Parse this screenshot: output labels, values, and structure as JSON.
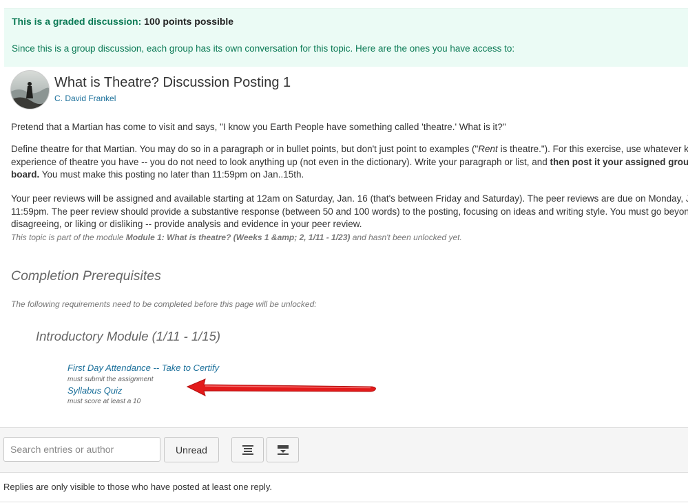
{
  "graded": {
    "label": "This is a graded discussion:",
    "points": "100 points possible",
    "group_note": "Since this is a group discussion, each group has its own conversation for this topic. Here are the ones you have access to:"
  },
  "topic": {
    "title": "What is Theatre? Discussion Posting 1",
    "author": "C. David Frankel"
  },
  "body": {
    "p1": "Pretend that a Martian has come to visit and says, \"I know you Earth People have something called 'theatre.'  What is it?\"",
    "p2_line1_a": "Define theatre for that Martian.  You may do so in a paragraph or in bullet points, but don't just point to examples (\"",
    "p2_line1_em": "Rent",
    "p2_line1_b": " is theatre.\").  For this exercise, use whatever k",
    "p2_line2_a": "experience of theatre you have -- you do not need to look anything up (not even in the dictionary).  Write your paragraph or list, and ",
    "p2_line2_bold": "then post it your assigned grou",
    "p2_line3_bold": "board.",
    "p2_line3_b": "  You must make this posting no later than 11:59pm on Jan..15th.",
    "p3_line1": "Your peer reviews will be assigned and available starting at 12am on Saturday, Jan. 16 (that's between Friday and Saturday).  The peer reviews are due on Monday, J",
    "p3_line2": "11:59pm. The peer review should provide a substantive response (between 50 and 100 words) to the posting, focusing on ideas and writing style.  You must go beyond",
    "p3_line3": "disagreeing, or liking or disliking -- provide analysis and evidence in your peer review."
  },
  "lock_note": {
    "before": "This topic is part of the module ",
    "module": "Module 1: What is theatre? (Weeks 1 &amp; 2, 1/11 - 1/23)",
    "after": " and hasn't been unlocked yet."
  },
  "prerequisites": {
    "heading": "Completion Prerequisites",
    "subtext": "The following requirements need to be completed before this page will be unlocked:",
    "module_name": "Introductory Module (1/11 - 1/15)",
    "items": [
      {
        "label": "First Day Attendance -- Take to Certify",
        "requirement": "must submit the assignment"
      },
      {
        "label": "Syllabus Quiz",
        "requirement": "must score at least a 10"
      }
    ]
  },
  "toolbar": {
    "search_placeholder": "Search entries or author",
    "unread_label": "Unread",
    "expand_icon": "expand-icon",
    "collapse_icon": "collapse-icon"
  },
  "replies_note": "Replies are only visible to those who have posted at least one reply.",
  "colors": {
    "banner_bg": "#ebfbf5",
    "banner_text": "#0b7a55",
    "link": "#1a6f9a",
    "arrow": "#e31a1a"
  }
}
